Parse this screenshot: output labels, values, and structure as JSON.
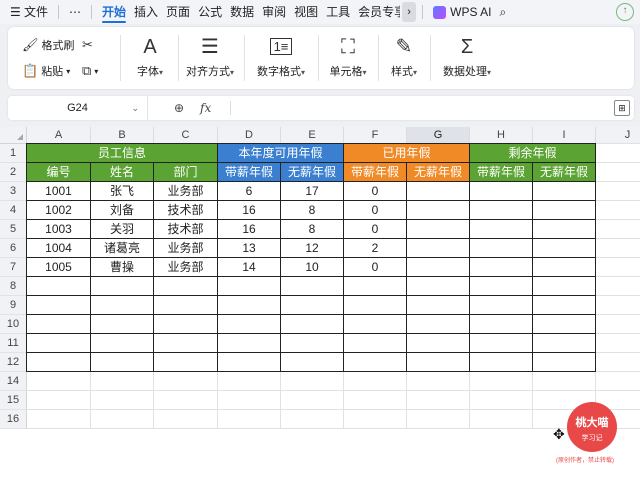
{
  "menu": {
    "file_label": "文件",
    "more_label": "⋯",
    "tabs": [
      "开始",
      "插入",
      "页面",
      "公式",
      "数据",
      "审阅",
      "视图",
      "工具",
      "会员专享"
    ],
    "active_tab": "开始",
    "ai_label": "WPS AI"
  },
  "ribbon": {
    "format_painter": "格式刷",
    "paste": "粘贴",
    "font": "字体",
    "align": "对齐方式",
    "number_format": "数字格式",
    "cell": "单元格",
    "style": "样式",
    "data_processing": "数据处理"
  },
  "formula_bar": {
    "name_box": "G24",
    "fx_label": "fx",
    "formula": ""
  },
  "columns": [
    "A",
    "B",
    "C",
    "D",
    "E",
    "F",
    "G",
    "H",
    "I",
    "J"
  ],
  "selected_column": "G",
  "row_numbers": [
    "1",
    "2",
    "3",
    "4",
    "5",
    "6",
    "7",
    "8",
    "9",
    "10",
    "11",
    "12",
    "14",
    "15",
    "16"
  ],
  "table": {
    "group_headers": {
      "employee_info": "员工信息",
      "available_leave": "本年度可用年假",
      "used_leave": "已用年假",
      "remaining_leave": "剩余年假"
    },
    "sub_headers": [
      "编号",
      "姓名",
      "部门",
      "带薪年假",
      "无薪年假",
      "带薪年假",
      "无薪年假",
      "带薪年假",
      "无薪年假"
    ],
    "rows": [
      [
        "1001",
        "张飞",
        "业务部",
        "6",
        "17",
        "0",
        "",
        "",
        ""
      ],
      [
        "1002",
        "刘备",
        "技术部",
        "16",
        "8",
        "0",
        "",
        "",
        ""
      ],
      [
        "1003",
        "关羽",
        "技术部",
        "16",
        "8",
        "0",
        "",
        "",
        ""
      ],
      [
        "1004",
        "诸葛亮",
        "业务部",
        "13",
        "12",
        "2",
        "",
        "",
        ""
      ],
      [
        "1005",
        "曹操",
        "业务部",
        "14",
        "10",
        "0",
        "",
        "",
        ""
      ]
    ]
  },
  "watermark": {
    "title": "桃大喵",
    "subtitle": "学习记",
    "note": "(原创作者，禁止转载)"
  },
  "colors": {
    "green_header": "#5ba332",
    "blue_header": "#3a7fd0",
    "orange_header": "#f08a26",
    "accent": "#1f6fd6"
  }
}
